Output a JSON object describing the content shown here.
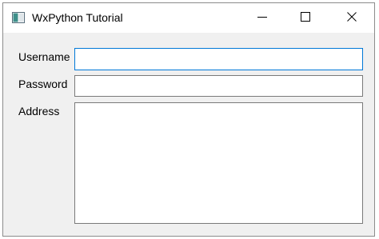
{
  "window": {
    "title": "WxPython Tutorial",
    "accent_color": "#0078d7"
  },
  "title_controls": {
    "minimize_icon": "minimize-icon",
    "maximize_icon": "maximize-icon",
    "close_icon": "close-icon"
  },
  "form": {
    "username_label": "Username",
    "username_value": "",
    "password_label": "Password",
    "password_value": "",
    "address_label": "Address",
    "address_value": ""
  }
}
